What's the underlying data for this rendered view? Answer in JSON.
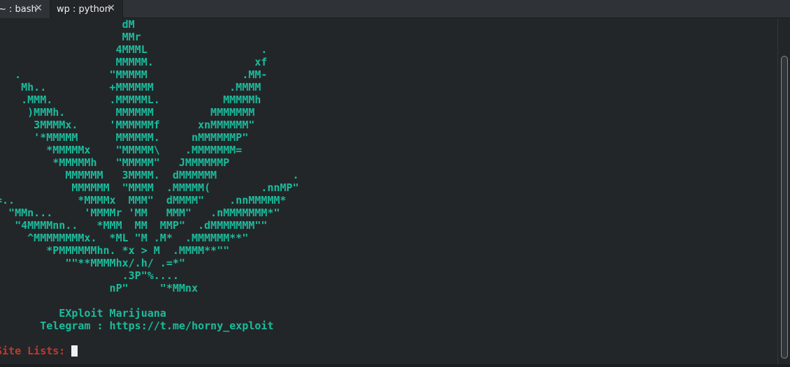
{
  "tabs": [
    {
      "label": "~ : bash",
      "close": "✕",
      "active": false
    },
    {
      "label": "wp : python",
      "close": "✕",
      "active": true
    }
  ],
  "terminal": {
    "ascii_art": [
      "                    dM",
      "                    MMr",
      "                   4MMML                  .",
      "                   MMMMM.                xf",
      "   .              \"MMMMM               .MM-",
      "    Mh..          +MMMMMM            .MMMM",
      "    .MMM.         .MMMMML.          MMMMMh",
      "     )MMMh.        MMMMMM         MMMMMMM",
      "      3MMMMx.     'MMMMMMf      xnMMMMMM\"",
      "      '*MMMMM      MMMMMM.     nMMMMMMP\"",
      "        *MMMMMx    \"MMMMM\\    .MMMMMMM=",
      "         *MMMMMh   \"MMMMM\"   JMMMMMMP",
      "           MMMMMM   3MMMM.  dMMMMMM            .",
      "            MMMMMM  \"MMMM  .MMMMM(        .nnMP\"",
      "=..          *MMMMx  MMM\"  dMMMM\"    .nnMMMMM*",
      "  \"MMn...     'MMMMr 'MM   MMM\"   .nMMMMMMM*\"",
      "   \"4MMMMnn..   *MMM  MM  MMP\"  .dMMMMMMM\"\"",
      "     ^MMMMMMMMx.  *ML \"M .M*  .MMMMMM**\"",
      "        *PMMMMMMhn. *x > M  .MMMM**\"\"",
      "           \"\"**MMMMhx/.h/ .=*\"",
      "                    .3P\"%....",
      "                  nP\"     \"*MMnx",
      "",
      "          EXploit Marijuana",
      "       Telegram : https://t.me/horny_exploit"
    ],
    "prompt_label": "Site Lists: "
  },
  "colors": {
    "background": "#232629",
    "art_green": "#1abc9c",
    "prompt_red": "#c0392b",
    "cursor": "#eff0f1"
  }
}
